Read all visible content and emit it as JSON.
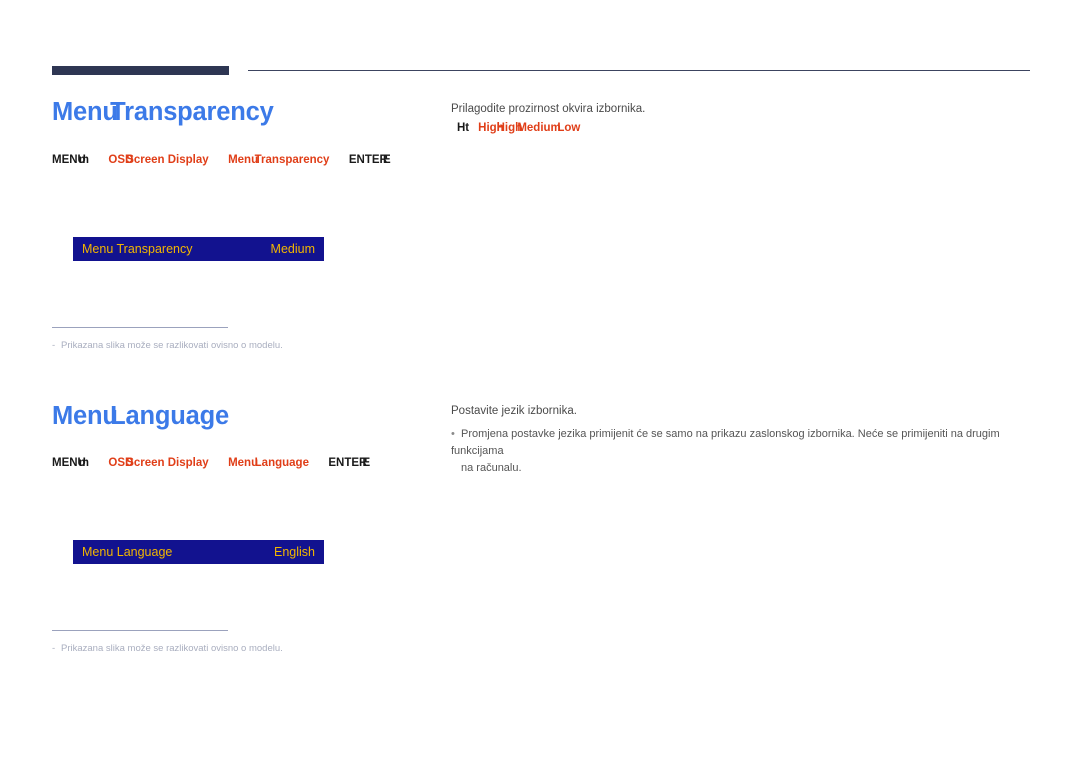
{
  "page": {
    "language": "hr",
    "background": "#ffffff",
    "accent_heading_color": "#3c7ae8",
    "accent_path_color": "#e03e18",
    "osd_background_color": "#12128f",
    "osd_text_color": "#f2b600",
    "rule_bar_color": "#2e3653"
  },
  "sections": [
    {
      "id": "menu-transparency",
      "title_a": "Menu",
      "title_b": "Transparency",
      "title_overlap": "T",
      "title_full": "Menu Transparency",
      "breadcrumb": {
        "menu_label": "MENU",
        "menu_overlap": "m",
        "path_1": "OSD",
        "path_1_overlap": "Screen Display",
        "path_2": "Menu",
        "path_2_overlap": "Transparency",
        "enter_label": "ENTER",
        "enter_overlap": "E",
        "full": "MENU m → OSD Screen Display → Menu Transparency → ENTER E"
      },
      "osd": {
        "label": "Menu Transparency",
        "value": "Medium"
      },
      "footnote": {
        "dash": "-",
        "text": "Prikazana slika može se razlikovati ovisno o modelu."
      },
      "right": {
        "lead": "Prilagodite prozirnost okvira izbornika.",
        "option_mark": "Ht",
        "option_1": "High",
        "option_1_overlap": "High",
        "option_2": "Medium",
        "option_3": "Low",
        "options_full": "High / Medium / Low"
      }
    },
    {
      "id": "menu-language",
      "title_a": "Menu",
      "title_b": "Language",
      "title_overlap": "L",
      "title_full": "Menu Language",
      "breadcrumb": {
        "menu_label": "MENU",
        "menu_overlap": "m",
        "path_1": "OSD",
        "path_1_overlap": "Screen Display",
        "path_2": "Menu",
        "path_2_overlap": "Language",
        "enter_label": "ENTER",
        "enter_overlap": "E",
        "full": "MENU m → OSD Screen Display → Menu Language → ENTER E"
      },
      "osd": {
        "label": "Menu Language",
        "value": "English"
      },
      "footnote": {
        "dash": "-",
        "text": "Prikazana slika može se razlikovati ovisno o modelu."
      },
      "right": {
        "lead": "Postavite jezik izbornika.",
        "note_bullet": "•",
        "note_line_1": "Promjena postavke jezika primijenit će se samo na prikazu zaslonskog izbornika. Neće se primijeniti na drugim funkcijama",
        "note_line_1_overlap": "N",
        "note_line_2": "na računalu."
      }
    }
  ]
}
